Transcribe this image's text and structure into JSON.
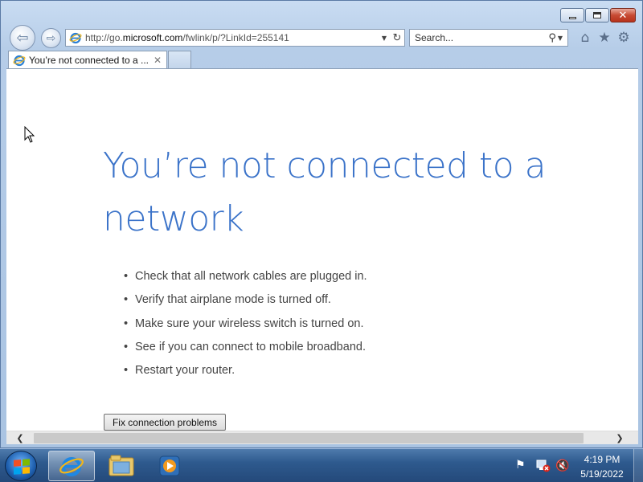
{
  "browser": {
    "address_url_prefix": "http://go.",
    "address_url_domain": "microsoft.com",
    "address_url_suffix": "/fwlink/p/?LinkId=255141",
    "search_placeholder": "Search...",
    "tab_title": "You’re not connected to a ...",
    "tab_close": "✕"
  },
  "page": {
    "title": "You’re not connected to a network",
    "tips": [
      "Check that all network cables are plugged in.",
      "Verify that airplane mode is turned off.",
      "Make sure your wireless switch is turned on.",
      "See if you can connect to mobile broadband.",
      "Restart your router."
    ],
    "fix_button_label": "Fix connection problems"
  },
  "taskbar": {
    "time": "4:19 PM",
    "date": "5/19/2022",
    "items": [
      "start-orb",
      "internet-explorer-icon",
      "windows-explorer-icon",
      "media-player-icon"
    ]
  },
  "colors": {
    "title": "#3b73c9",
    "taskbar": "#2e5a8e",
    "text": "#444444"
  }
}
